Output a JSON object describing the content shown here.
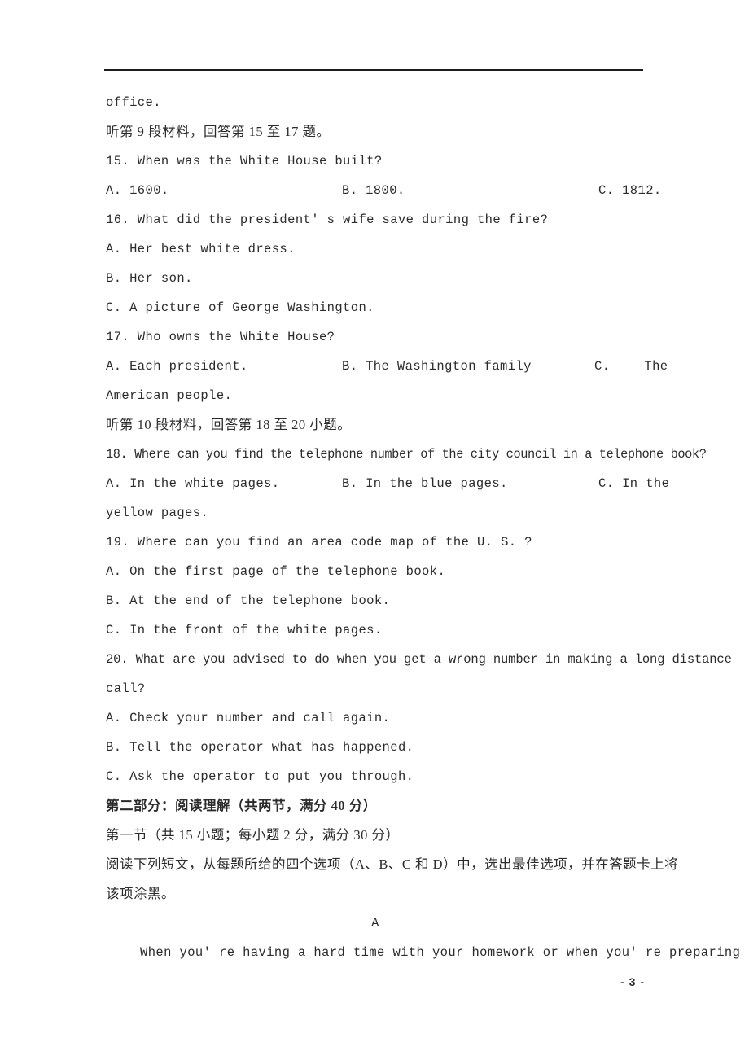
{
  "document": {
    "page_number": "- 3 -",
    "lines": {
      "office": "office.",
      "listen_9": "听第 9 段材料，回答第 15 至 17 题。",
      "q15": "15. When was the White House built?",
      "q15_a": "A. 1600.",
      "q15_b": "B. 1800.",
      "q15_c": "C. 1812.",
      "q16": "16. What did the president' s wife save during the fire?",
      "q16_a": "A. Her best white dress.",
      "q16_b": "B. Her son.",
      "q16_c": "C. A picture of George Washington.",
      "q17": "17. Who owns the White House?",
      "q17_a": "A. Each president.",
      "q17_b": "B. The Washington family",
      "q17_c_label": "C.",
      "q17_c_text": "The",
      "q17_c_cont": "American people.",
      "listen_10": "听第 10 段材料，回答第 18 至 20 小题。",
      "q18": "18. Where can you find the telephone number of the city council in a telephone book?",
      "q18_a": "A. In the white pages.",
      "q18_b": "B. In the blue pages.",
      "q18_c": "C. In the",
      "q18_c_cont": "yellow pages.",
      "q19": "19. Where can you find an area code map of the U. S. ?",
      "q19_a": "A. On the first page of the telephone book.",
      "q19_b": "B. At the end of the telephone book.",
      "q19_c": "C. In the front of the white pages.",
      "q20": "20. What are you advised to do when you get a wrong number in making a long distance",
      "q20_cont": "call?",
      "q20_a": "A. Check your number and call again.",
      "q20_b": "B. Tell the operator what has happened.",
      "q20_c": "C. Ask the operator to put you through.",
      "part_two_heading": "第二部分：阅读理解（共两节，满分 40 分）",
      "section_one": "第一节（共 15 小题；每小题 2 分，满分 30 分）",
      "instructions_1": "阅读下列短文，从每题所给的四个选项（A、B、C 和 D）中，选出最佳选项，并在答题卡上将",
      "instructions_2": "该项涂黑。",
      "passage_label": "A",
      "passage_line_1": "When you' re having a hard time with your homework or when you' re preparing for"
    }
  }
}
